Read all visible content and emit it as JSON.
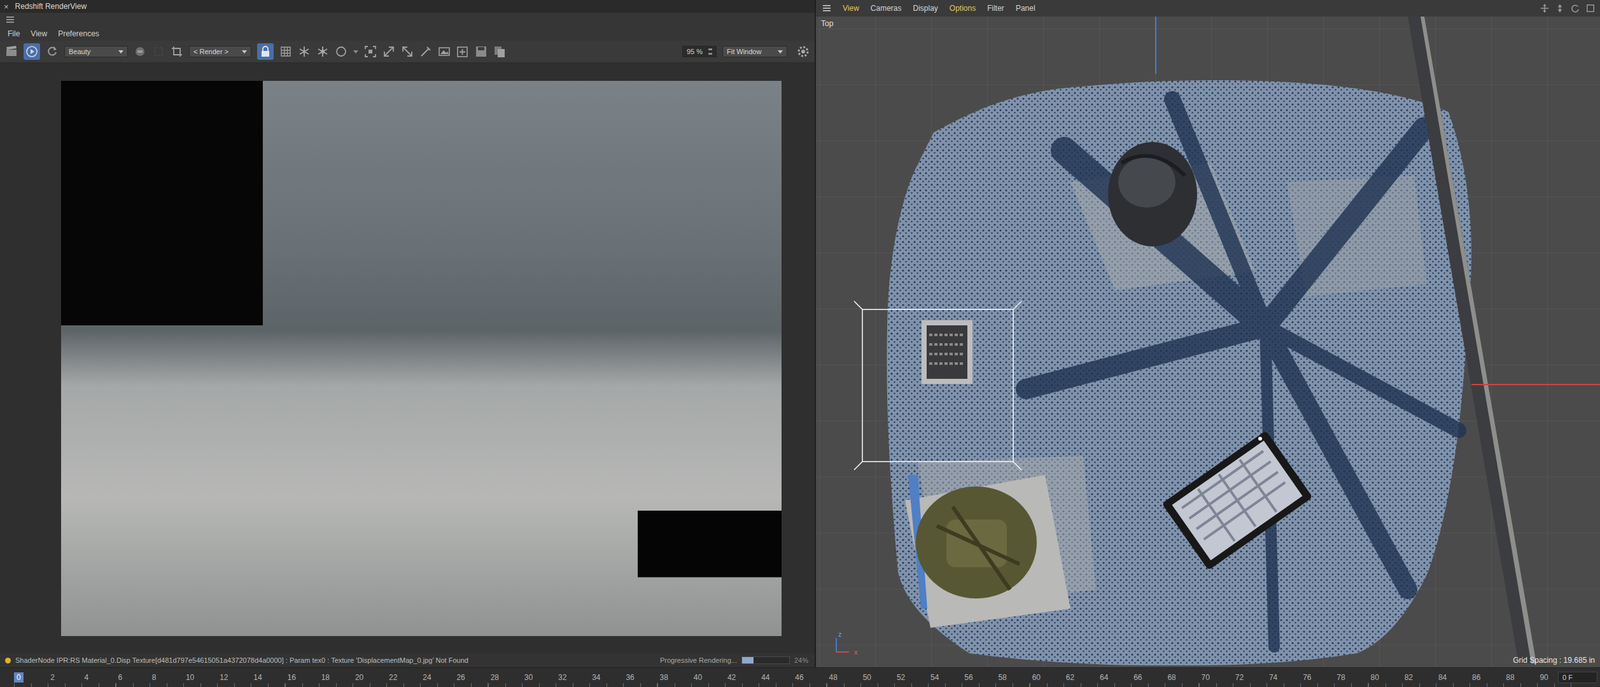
{
  "window": {
    "title": "Redshift RenderView",
    "close_icon": "×"
  },
  "render_view": {
    "menu": [
      "File",
      "View",
      "Preferences"
    ],
    "toolbar": {
      "ipr_on": true,
      "aov": "Beauty",
      "camera": "< Render >",
      "lock_on": true,
      "zoom": "95 %",
      "fit": "Fit Window"
    },
    "status": {
      "message": "ShaderNode IPR:RS Material_0.Disp Texture[d481d797e54615051a4372078d4a0000] : Param tex0 : Texture 'DisplacementMap_0.jpg' Not Found",
      "progress_label": "Progressive Rendering...",
      "progress_text": "24%",
      "level": 0.24
    }
  },
  "viewport": {
    "menu": [
      {
        "label": "View",
        "highlighted": true
      },
      {
        "label": "Cameras",
        "highlighted": false
      },
      {
        "label": "Display",
        "highlighted": false
      },
      {
        "label": "Options",
        "highlighted": true
      },
      {
        "label": "Filter",
        "highlighted": false
      },
      {
        "label": "Panel",
        "highlighted": false
      }
    ],
    "view_name": "Top",
    "grid_spacing": "Grid Spacing : 19.685 in",
    "axis": {
      "vertical": "z",
      "horizontal": "x"
    }
  },
  "timeline": {
    "ticks": [
      {
        "label": "0",
        "selected": true
      },
      {
        "label": "2",
        "selected": false
      },
      {
        "label": "4",
        "selected": false
      },
      {
        "label": "6",
        "selected": false
      },
      {
        "label": "8",
        "selected": false
      },
      {
        "label": "10",
        "selected": false
      },
      {
        "label": "12",
        "selected": false
      },
      {
        "label": "14",
        "selected": false
      },
      {
        "label": "16",
        "selected": false
      },
      {
        "label": "18",
        "selected": false
      },
      {
        "label": "20",
        "selected": false
      },
      {
        "label": "22",
        "selected": false
      },
      {
        "label": "24",
        "selected": false
      },
      {
        "label": "26",
        "selected": false
      },
      {
        "label": "28",
        "selected": false
      },
      {
        "label": "30",
        "selected": false
      },
      {
        "label": "32",
        "selected": false
      },
      {
        "label": "34",
        "selected": false
      },
      {
        "label": "36",
        "selected": false
      },
      {
        "label": "38",
        "selected": false
      },
      {
        "label": "40",
        "selected": false
      },
      {
        "label": "42",
        "selected": false
      },
      {
        "label": "44",
        "selected": false
      },
      {
        "label": "46",
        "selected": false
      },
      {
        "label": "48",
        "selected": false
      },
      {
        "label": "50",
        "selected": false
      },
      {
        "label": "52",
        "selected": false
      },
      {
        "label": "54",
        "selected": false
      },
      {
        "label": "56",
        "selected": false
      },
      {
        "label": "58",
        "selected": false
      },
      {
        "label": "60",
        "selected": false
      },
      {
        "label": "62",
        "selected": false
      },
      {
        "label": "64",
        "selected": false
      },
      {
        "label": "66",
        "selected": false
      },
      {
        "label": "68",
        "selected": false
      },
      {
        "label": "70",
        "selected": false
      },
      {
        "label": "72",
        "selected": false
      },
      {
        "label": "74",
        "selected": false
      },
      {
        "label": "76",
        "selected": false
      },
      {
        "label": "78",
        "selected": false
      },
      {
        "label": "80",
        "selected": false
      },
      {
        "label": "82",
        "selected": false
      },
      {
        "label": "84",
        "selected": false
      },
      {
        "label": "86",
        "selected": false
      },
      {
        "label": "88",
        "selected": false
      },
      {
        "label": "90",
        "selected": false
      }
    ],
    "current_frame": "0 F"
  }
}
